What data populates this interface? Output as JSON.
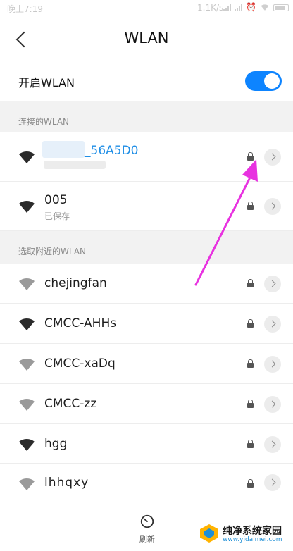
{
  "status_bar": {
    "time": "晚上7:19",
    "speed": "1.1K/s"
  },
  "header": {
    "title": "WLAN"
  },
  "toggle": {
    "label": "开启WLAN",
    "enabled": true,
    "color": "#0d84ff"
  },
  "sections": {
    "connected_label": "连接的WLAN",
    "nearby_label": "选取附近的WLAN"
  },
  "connected": [
    {
      "ssid": "_56A5D0",
      "status": "",
      "locked": true,
      "icon": "wifi-icon"
    },
    {
      "ssid": "005",
      "status": "已保存",
      "locked": true,
      "icon": "wifi-icon"
    }
  ],
  "nearby": [
    {
      "ssid": "chejingfan",
      "locked": true,
      "icon": "wifi-icon"
    },
    {
      "ssid": "CMCC-AHHs",
      "locked": true,
      "icon": "wifi-icon"
    },
    {
      "ssid": "CMCC-xaDq",
      "locked": true,
      "icon": "wifi-icon"
    },
    {
      "ssid": "CMCC-zz",
      "locked": true,
      "icon": "wifi-icon"
    },
    {
      "ssid": "hgg",
      "locked": true,
      "icon": "wifi-icon"
    },
    {
      "ssid": "lhhqxy",
      "locked": true,
      "icon": "wifi-icon"
    }
  ],
  "bottom_bar": {
    "refresh_label": "刷新",
    "icon": "refresh-icon"
  },
  "watermark": {
    "title": "纯净系统家园",
    "url": "www.yidaimei.com"
  },
  "colors": {
    "accent": "#0d84ff",
    "connected_text": "#1f8ee6",
    "annotation_arrow": "#e832e0"
  }
}
